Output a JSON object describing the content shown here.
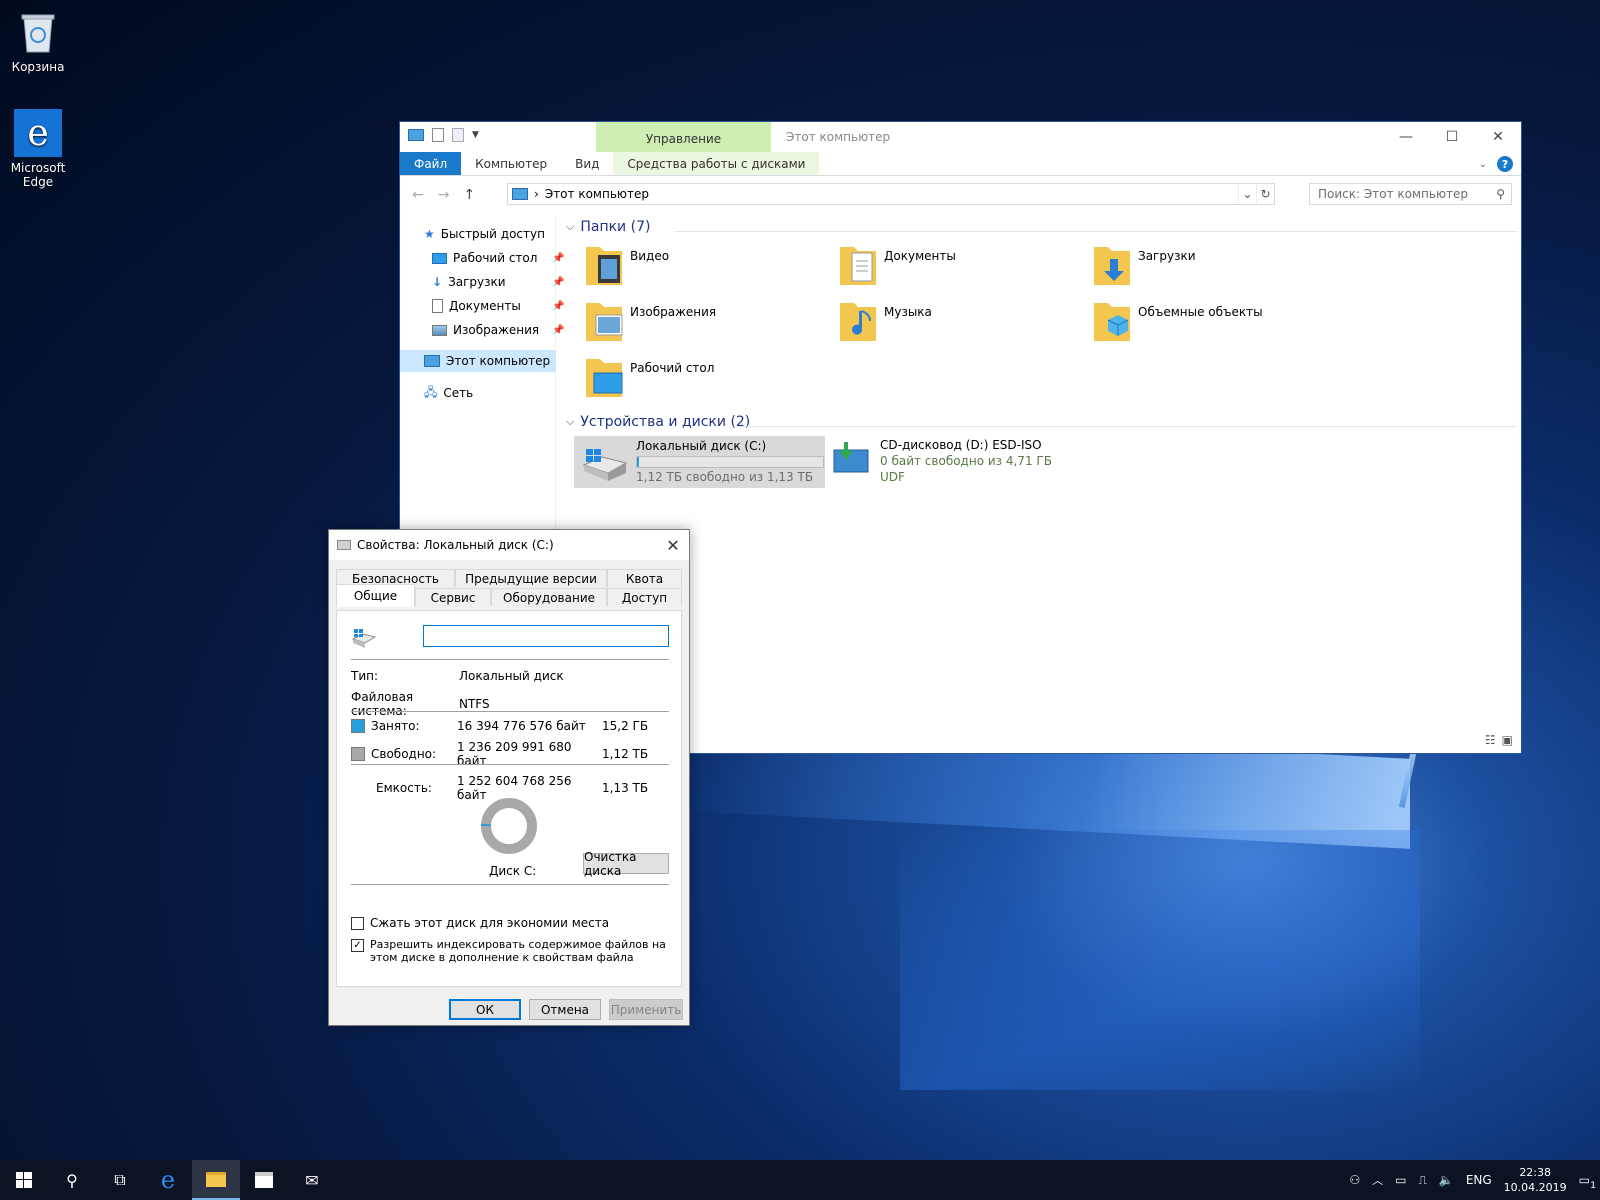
{
  "desktop": {
    "recycle_bin_label": "Корзина",
    "edge_label": "Microsoft Edge"
  },
  "explorer": {
    "title": "Этот компьютер",
    "context_tab_header": "Управление",
    "tabs": {
      "file": "Файл",
      "computer": "Компьютер",
      "view": "Вид",
      "drive_tools": "Средства работы с дисками"
    },
    "address": "Этот компьютер",
    "search_placeholder": "Поиск: Этот компьютер",
    "nav": {
      "quick_access": "Быстрый доступ",
      "desktop": "Рабочий стол",
      "downloads": "Загрузки",
      "documents": "Документы",
      "pictures": "Изображения",
      "this_pc": "Этот компьютер",
      "network": "Сеть"
    },
    "folders_header": "Папки (7)",
    "folders": [
      "Видео",
      "Документы",
      "Загрузки",
      "Изображения",
      "Музыка",
      "Объемные объекты",
      "Рабочий стол"
    ],
    "devices_header": "Устройства и диски (2)",
    "drive_c": {
      "name": "Локальный диск (C:)",
      "free": "1,12 ТБ свободно из 1,13 ТБ",
      "used_fraction": 0.013
    },
    "drive_d": {
      "name": "CD-дисковод (D:) ESD-ISO",
      "free": "0 байт свободно из 4,71 ГБ",
      "fs": "UDF"
    }
  },
  "dialog": {
    "title": "Свойства: Локальный диск (C:)",
    "tabs_top": [
      "Безопасность",
      "Предыдущие версии",
      "Квота"
    ],
    "tabs_bottom": [
      "Общие",
      "Сервис",
      "Оборудование",
      "Доступ"
    ],
    "name_value": "",
    "type_label": "Тип:",
    "type_value": "Локальный диск",
    "fs_label": "Файловая система:",
    "fs_value": "NTFS",
    "used_label": "Занято:",
    "used_bytes": "16 394 776 576 байт",
    "used_size": "15,2 ГБ",
    "free_label": "Свободно:",
    "free_bytes": "1 236 209 991 680 байт",
    "free_size": "1,12 ТБ",
    "capacity_label": "Емкость:",
    "capacity_bytes": "1 252 604 768 256 байт",
    "capacity_size": "1,13 ТБ",
    "disk_label": "Диск C:",
    "cleanup_button": "Очистка диска",
    "compress_label": "Сжать этот диск для экономии места",
    "compress_checked": false,
    "index_label": "Разрешить индексировать содержимое файлов на этом диске в дополнение к свойствам файла",
    "index_checked": true,
    "ok": "ОК",
    "cancel": "Отмена",
    "apply": "Применить",
    "used_color": "#26a0da",
    "free_color": "#a8a8a8",
    "used_fraction": 0.013
  },
  "taskbar": {
    "lang": "ENG",
    "time": "22:38",
    "date": "10.04.2019",
    "notifications": "1"
  }
}
